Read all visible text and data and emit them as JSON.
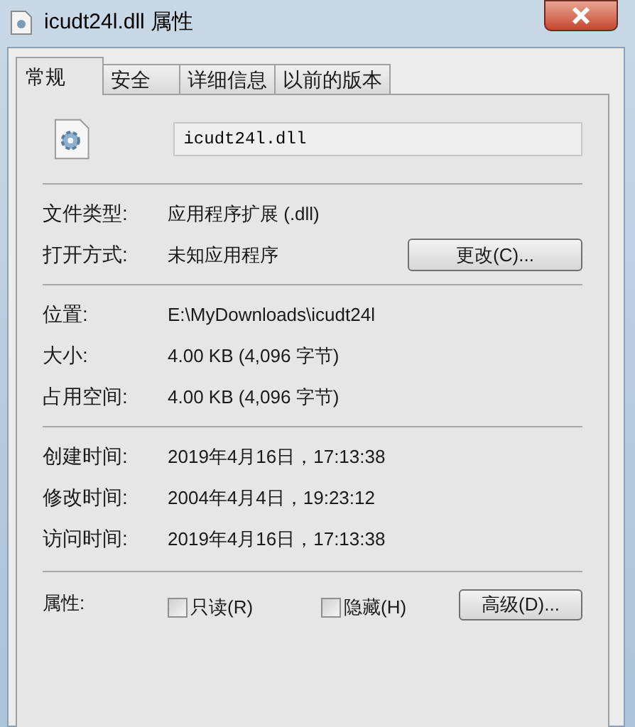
{
  "window": {
    "title": "icudt24l.dll 属性"
  },
  "tabs": [
    {
      "label": "常规",
      "selected": true
    },
    {
      "label": "安全",
      "selected": false
    },
    {
      "label": "详细信息",
      "selected": false
    },
    {
      "label": "以前的版本",
      "selected": false
    }
  ],
  "file_name": {
    "value": "icudt24l.dll"
  },
  "sections": [
    {
      "rows": [
        {
          "label": "文件类型:",
          "value": "应用程序扩展 (.dll)"
        },
        {
          "label": "打开方式:",
          "value": "未知应用程序",
          "button": "更改(C)..."
        }
      ]
    },
    {
      "rows": [
        {
          "label": "位置:",
          "value": "E:\\MyDownloads\\icudt24l"
        },
        {
          "label": "大小:",
          "value": "4.00 KB (4,096 字节)"
        },
        {
          "label": "占用空间:",
          "value": "4.00 KB (4,096 字节)"
        }
      ]
    },
    {
      "rows": [
        {
          "label": "创建时间:",
          "value": "2019年4月16日，17:13:38"
        },
        {
          "label": "修改时间:",
          "value": "2004年4月4日，19:23:12"
        },
        {
          "label": "访问时间:",
          "value": "2019年4月16日，17:13:38"
        }
      ]
    }
  ],
  "attributes": {
    "label": "属性:",
    "checkboxes": [
      {
        "label": "只读(R)",
        "checked": false
      },
      {
        "label": "隐藏(H)",
        "checked": false
      }
    ],
    "button": "高级(D)..."
  }
}
